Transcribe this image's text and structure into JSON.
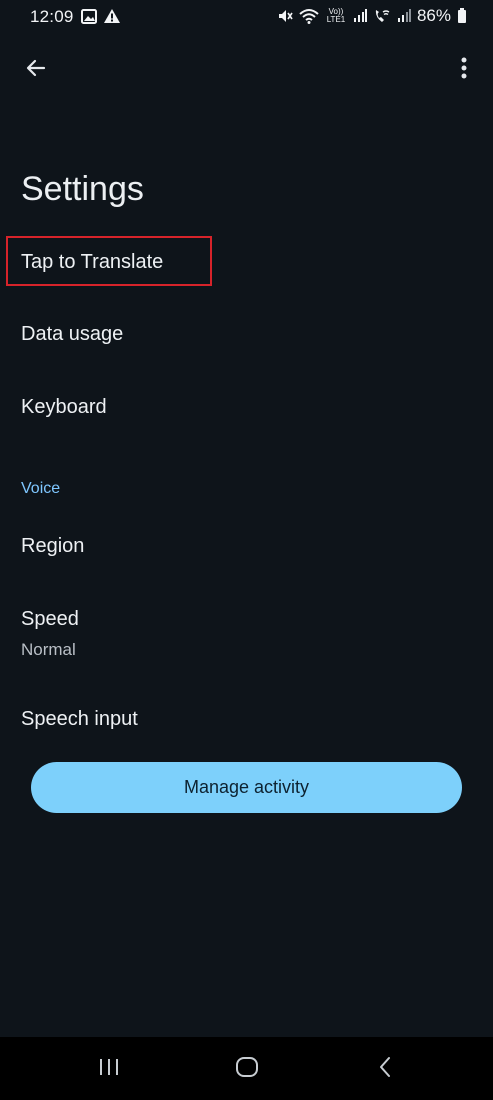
{
  "status_bar": {
    "time": "12:09",
    "battery": "86%",
    "network_label": "Vo)) LTE1"
  },
  "app_bar": {
    "back_icon": "arrow-left-icon",
    "more_icon": "more-vert-icon"
  },
  "page": {
    "title": "Settings"
  },
  "settings": {
    "tap_to_translate": "Tap to Translate",
    "data_usage": "Data usage",
    "keyboard": "Keyboard",
    "voice_header": "Voice",
    "region": "Region",
    "speed": "Speed",
    "speed_value": "Normal",
    "speech_input": "Speech input"
  },
  "actions": {
    "manage_activity": "Manage activity"
  },
  "colors": {
    "background": "#0e141a",
    "accent": "#7fc7ff",
    "button": "#7dd0fb",
    "highlight": "#d6232a"
  }
}
